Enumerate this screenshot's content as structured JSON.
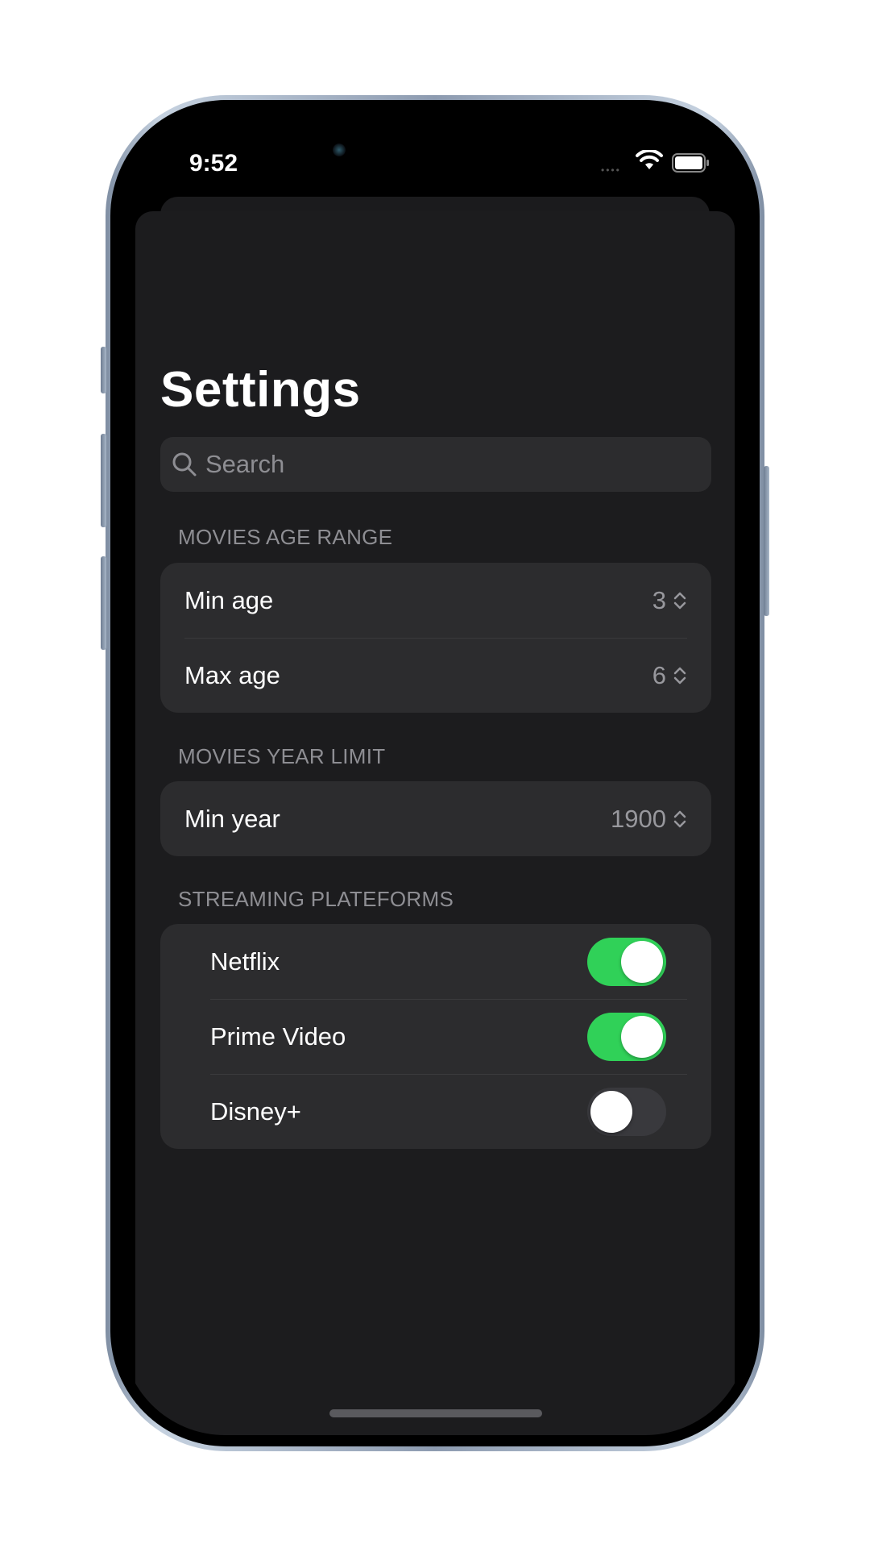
{
  "status_bar": {
    "time": "9:52"
  },
  "page": {
    "title": "Settings"
  },
  "search": {
    "placeholder": "Search"
  },
  "sections": {
    "age": {
      "header": "MOVIES AGE RANGE",
      "rows": [
        {
          "label": "Min age",
          "value": "3"
        },
        {
          "label": "Max age",
          "value": "6"
        }
      ]
    },
    "year": {
      "header": "MOVIES YEAR LIMIT",
      "rows": [
        {
          "label": "Min year",
          "value": "1900"
        }
      ]
    },
    "platforms": {
      "header": "STREAMING PLATEFORMS",
      "rows": [
        {
          "label": "Netflix",
          "on": true
        },
        {
          "label": "Prime Video",
          "on": true
        },
        {
          "label": "Disney+",
          "on": false
        }
      ]
    }
  },
  "colors": {
    "toggle_on": "#30d158",
    "toggle_off": "#39393d",
    "cell_background": "#2c2c2e",
    "screen_background": "#1c1c1e"
  }
}
